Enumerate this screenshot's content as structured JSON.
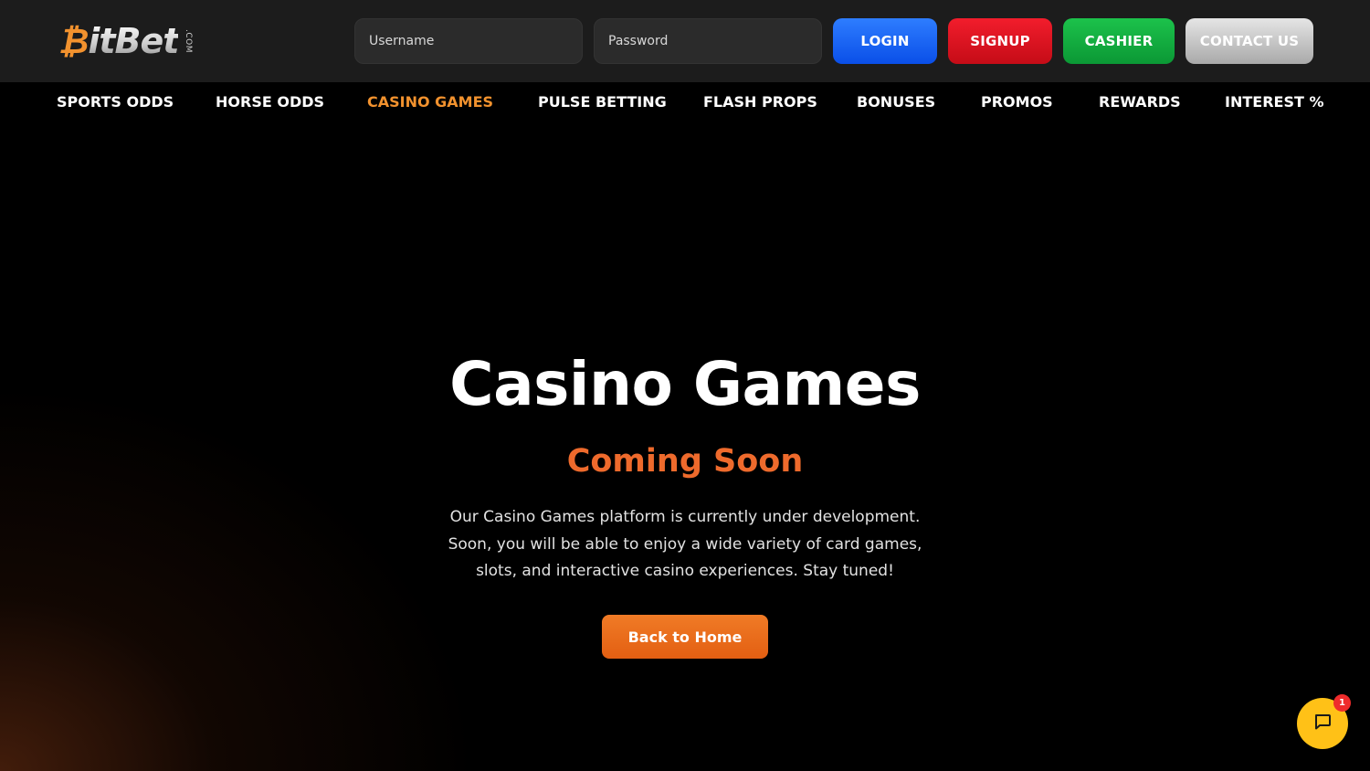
{
  "logo": {
    "b": "₿",
    "rest": "itBet",
    "suffix": ".COM"
  },
  "login": {
    "username_placeholder": "Username",
    "password_placeholder": "Password",
    "login_label": "LOGIN",
    "signup_label": "SIGNUP",
    "cashier_label": "CASHIER",
    "contact_label": "CONTACT US"
  },
  "nav": {
    "items": [
      {
        "label": "SPORTS ODDS"
      },
      {
        "label": "HORSE ODDS"
      },
      {
        "label": "CASINO GAMES",
        "active": true
      },
      {
        "label": "PULSE BETTING"
      },
      {
        "label": "FLASH PROPS"
      },
      {
        "label": "BONUSES"
      },
      {
        "label": "PROMOS"
      },
      {
        "label": "REWARDS"
      },
      {
        "label": "INTEREST %"
      }
    ]
  },
  "hero": {
    "title": "Casino Games",
    "subtitle": "Coming Soon",
    "description_lines": [
      "Our Casino Games platform is currently under development.",
      "Soon, you will be able to enjoy a wide variety of card games,",
      "slots, and interactive casino experiences. Stay tuned!"
    ],
    "button_label": "Back to Home"
  },
  "chat": {
    "icon": "chat-bubble-icon",
    "badge_count": "1"
  },
  "colors": {
    "accent": "#f2922e",
    "subtitle": "#ee6a2c",
    "login": "#0a4fe8",
    "signup": "#c50c17",
    "cashier": "#0b9835",
    "chat": "#ffc117"
  }
}
